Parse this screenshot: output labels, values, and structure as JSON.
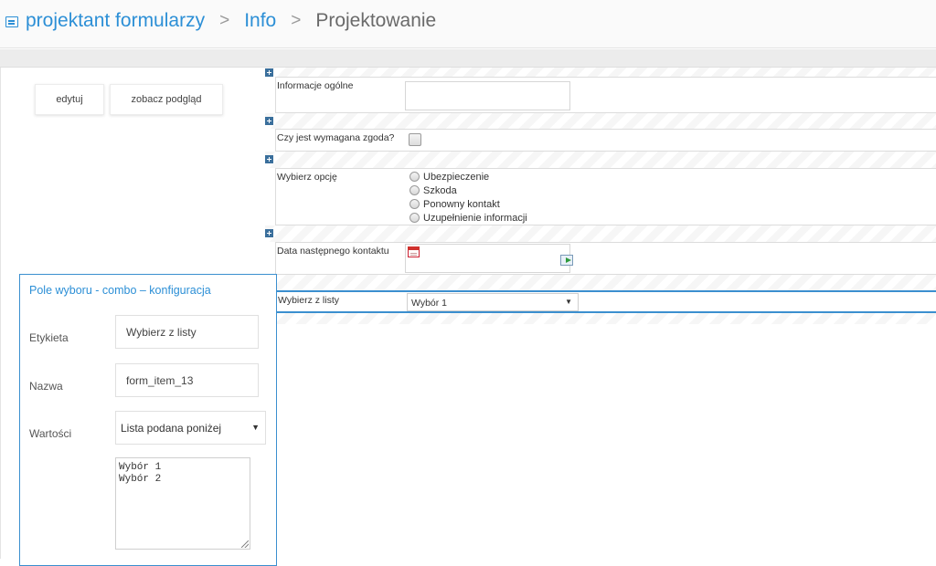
{
  "breadcrumb": {
    "root": "projektant formularzy",
    "separator": ">",
    "middle": "Info",
    "current": "Projektowanie"
  },
  "toolbar": {
    "edit": "edytuj",
    "preview": "zobacz podgląd"
  },
  "form": {
    "field1_label": "Informacje ogólne",
    "field2_label": "Czy jest wymagana zgoda?",
    "field3_label": "Wybierz opcję",
    "field3_options": [
      "Ubezpieczenie",
      "Szkoda",
      "Ponowny kontakt",
      "Uzupełnienie informacji"
    ],
    "field4_label": "Data następnego kontaktu",
    "field5_label": "Wybierz z listy",
    "field5_value": "Wybór 1"
  },
  "panel": {
    "title": "Pole wyboru - combo – konfiguracja",
    "label_label": "Etykieta",
    "label_value": "Wybierz z listy",
    "name_label": "Nazwa",
    "name_value": "form_item_13",
    "values_label": "Wartości",
    "values_select": "Lista podana poniżej",
    "values_list": [
      "Wybór 1",
      "Wybór 2"
    ]
  },
  "icons": {
    "breadcrumb": "form-icon",
    "add": "plus-icon",
    "calendar": "calendar-icon",
    "go": "go-arrow-icon",
    "dropdown": "chevron-down-icon"
  },
  "colors": {
    "accent": "#2c8fd6",
    "panel_border": "#3b8fcf"
  }
}
